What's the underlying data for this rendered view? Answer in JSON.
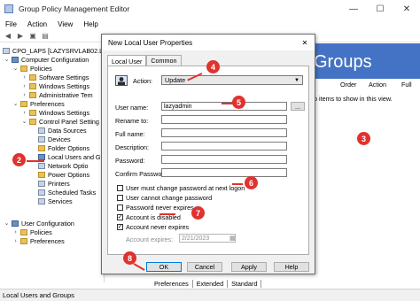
{
  "window": {
    "title": "Group Policy Management Editor",
    "menu": [
      "File",
      "Action",
      "View",
      "Help"
    ],
    "controls": {
      "minimize": "—",
      "maximize": "☐",
      "close": "✕"
    }
  },
  "tree": {
    "root": "CPO_LAPS [LAZYSRVLAB02.LAZ",
    "computer_config": "Computer Configuration",
    "policies": "Policies",
    "software_settings": "Software Settings",
    "windows_settings": "Windows Settings",
    "admin_templates": "Administrative Tem",
    "preferences": "Preferences",
    "pref_windows_settings": "Windows Settings",
    "control_panel": "Control Panel Setting",
    "data_sources": "Data Sources",
    "devices": "Devices",
    "folder_options": "Folder Options",
    "local_users": "Local Users and G",
    "network_options": "Network Optio",
    "power_options": "Power Options",
    "printers": "Printers",
    "scheduled_tasks": "Scheduled Tasks",
    "services": "Services",
    "user_config": "User Configuration",
    "u_policies": "Policies",
    "u_preferences": "Preferences"
  },
  "right_pane": {
    "banner": "Groups",
    "columns": [
      "Order",
      "Action",
      "Full"
    ],
    "empty_text": "o items to show in this view."
  },
  "bottom_tabs": [
    "Preferences",
    "Extended",
    "Standard"
  ],
  "status_text": "Local Users and Groups",
  "dialog": {
    "title": "New Local User Properties",
    "close": "✕",
    "tabs": [
      "Local User",
      "Common"
    ],
    "action_label": "Action:",
    "action_value": "Update",
    "username_label": "User name:",
    "username_value": "lazyadmin",
    "browse_label": "...",
    "rename_label": "Rename to:",
    "fullname_label": "Full name:",
    "description_label": "Description:",
    "password_label": "Password:",
    "confirm_label": "Confirm Password:",
    "checkboxes": {
      "must_change": {
        "label": "User must change password at next logon",
        "checked": false
      },
      "cannot_change": {
        "label": "User cannot change password",
        "checked": false
      },
      "never_expires": {
        "label": "Password never expires",
        "checked": false
      },
      "disabled": {
        "label": "Account is disabled",
        "checked": true
      },
      "account_never_expires": {
        "label": "Account never expires",
        "checked": true
      }
    },
    "expires_label": "Account expires:",
    "expires_value": "2/21/2023",
    "buttons": {
      "ok": "OK",
      "cancel": "Cancel",
      "apply": "Apply",
      "help": "Help"
    }
  },
  "callouts": [
    "2",
    "3",
    "4",
    "5",
    "6",
    "7",
    "8"
  ],
  "colors": {
    "accent": "#4472c4",
    "callout": "#e0322e",
    "dialog_bg": "#f0f0f0"
  }
}
